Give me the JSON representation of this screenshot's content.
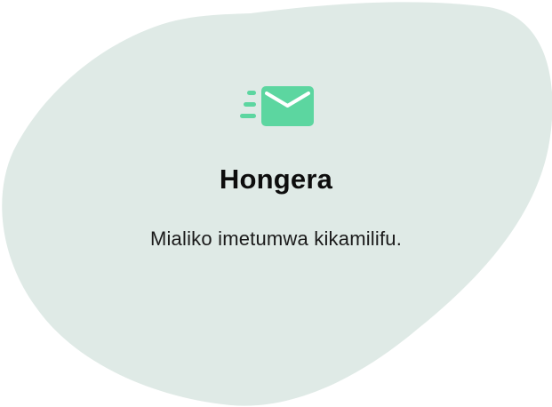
{
  "dialog": {
    "icon": "sent-mail-icon",
    "title": "Hongera",
    "message": "Mialiko imetumwa kikamilifu."
  },
  "colors": {
    "blob": "#dfeae6",
    "icon": "#5cd6a0",
    "icon_line": "#ffffff",
    "title": "#0d0d0d",
    "text": "#1a1a1a"
  }
}
